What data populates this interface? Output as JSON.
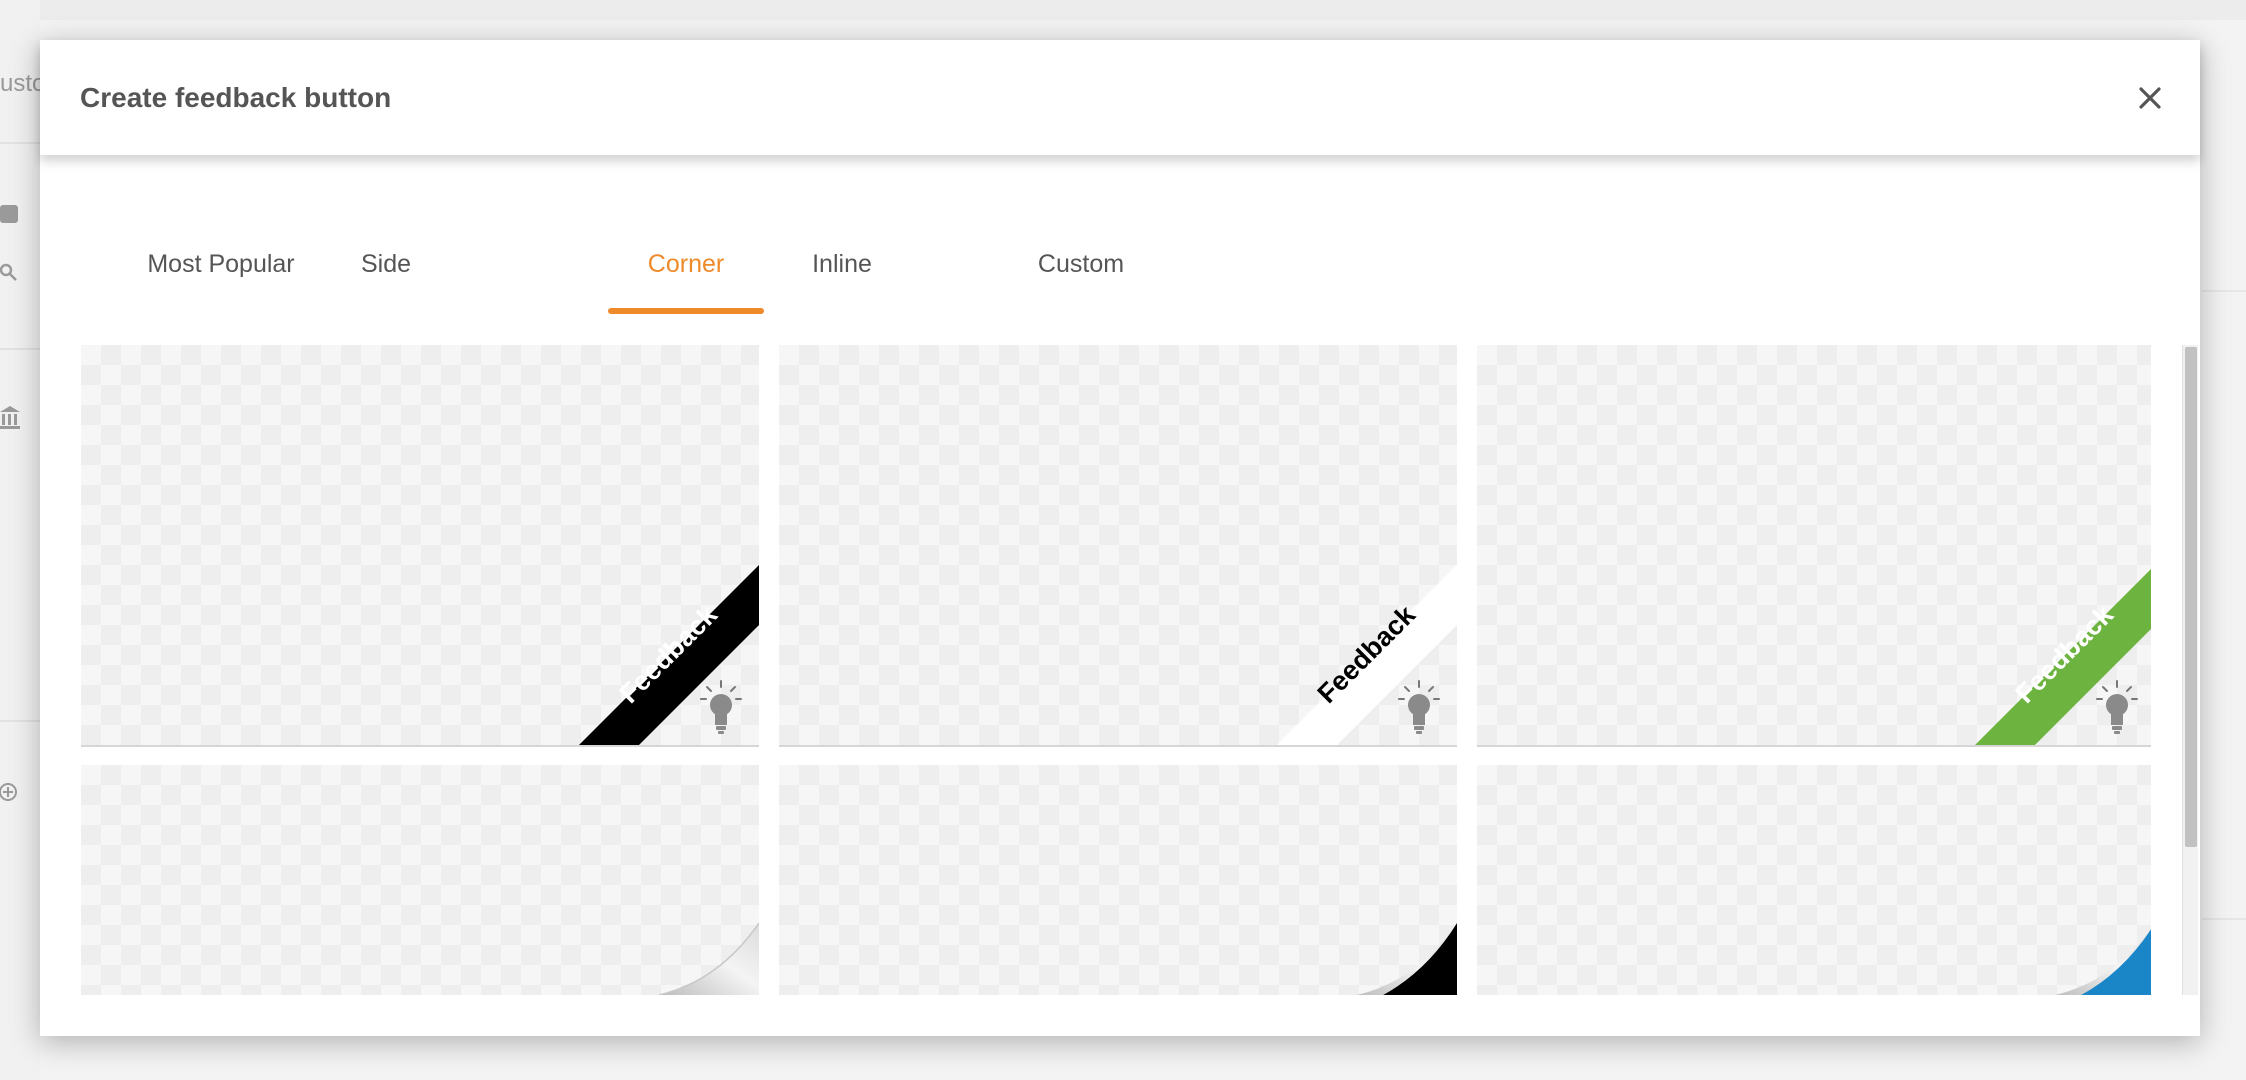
{
  "background": {
    "sidebar_fragment": "usto"
  },
  "modal": {
    "title": "Create feedback button",
    "close_icon": "close-icon"
  },
  "tabs": [
    {
      "label": "Most Popular",
      "active": false
    },
    {
      "label": "Side",
      "active": false
    },
    {
      "label": "Corner",
      "active": true
    },
    {
      "label": "Inline",
      "active": false
    },
    {
      "label": "Custom",
      "active": false
    }
  ],
  "accent_color": "#ef8a2b",
  "cards": [
    {
      "style": "ribbon",
      "ribbon_text": "Feedback",
      "ribbon_color": "#000000",
      "text_color": "#ffffff",
      "icon": "lightbulb-icon"
    },
    {
      "style": "ribbon",
      "ribbon_text": "Feedback",
      "ribbon_color": "#ffffff",
      "text_color": "#000000",
      "icon": "lightbulb-icon"
    },
    {
      "style": "ribbon",
      "ribbon_text": "Feedback",
      "ribbon_color": "#6cb33f",
      "text_color": "#ffffff",
      "icon": "lightbulb-icon"
    },
    {
      "style": "page-curl",
      "curl_color": "#e6e6e6"
    },
    {
      "style": "page-curl",
      "curl_color": "#000000"
    },
    {
      "style": "page-curl",
      "curl_color": "#1a86c8"
    }
  ]
}
